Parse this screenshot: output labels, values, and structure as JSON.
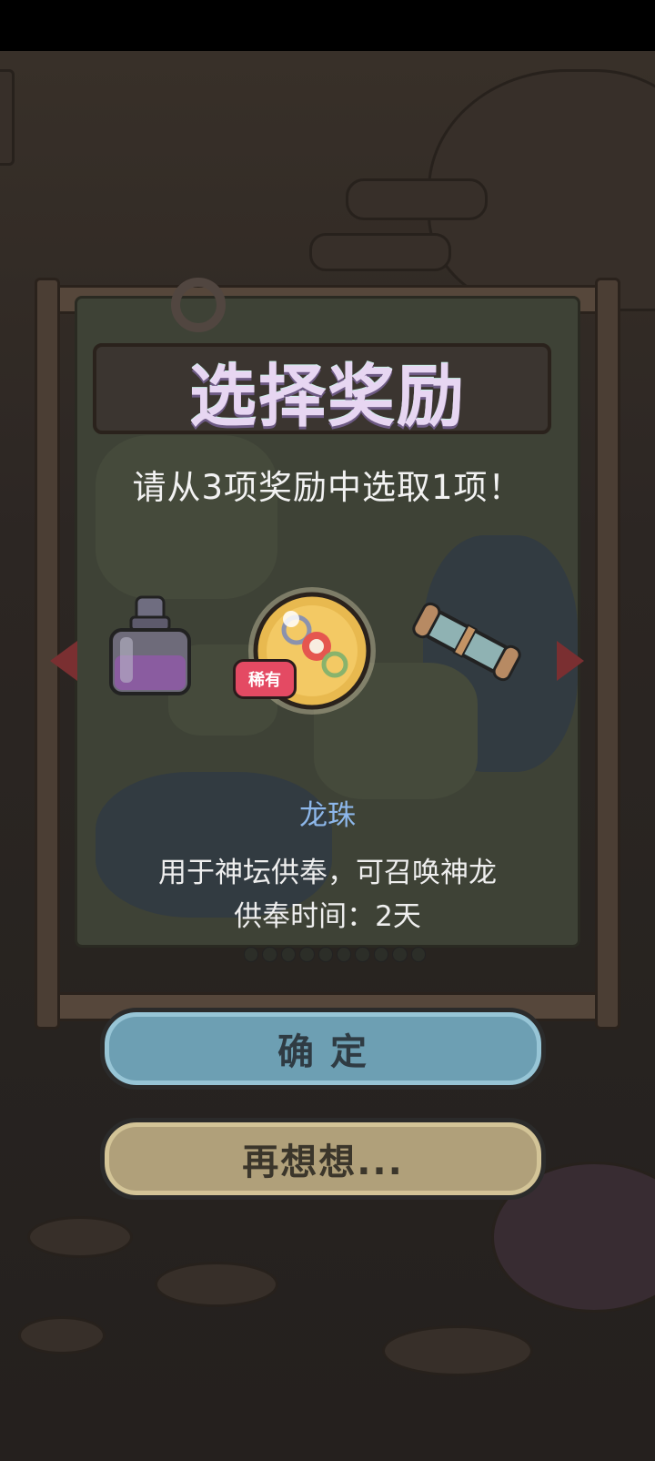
{
  "dialog": {
    "title": "选择奖励",
    "subtitle": "请从3项奖励中选取1项！"
  },
  "items": [
    {
      "icon": "potion-bottle-icon"
    },
    {
      "icon": "dragon-orb-icon",
      "badge": "稀有"
    },
    {
      "icon": "scroll-icon"
    }
  ],
  "selected_item": {
    "name": "龙珠",
    "description": "用于神坛供奉，可召唤神龙",
    "offering_time": "供奉时间：2天"
  },
  "buttons": {
    "confirm": "确 定",
    "reconsider": "再想想..."
  },
  "colors": {
    "title": "#e7d6f2",
    "item_name": "#8db7ea",
    "confirm_button": "#6d9fb3",
    "reconsider_button": "#b0a07a",
    "rarity_badge": "#e44a63"
  }
}
